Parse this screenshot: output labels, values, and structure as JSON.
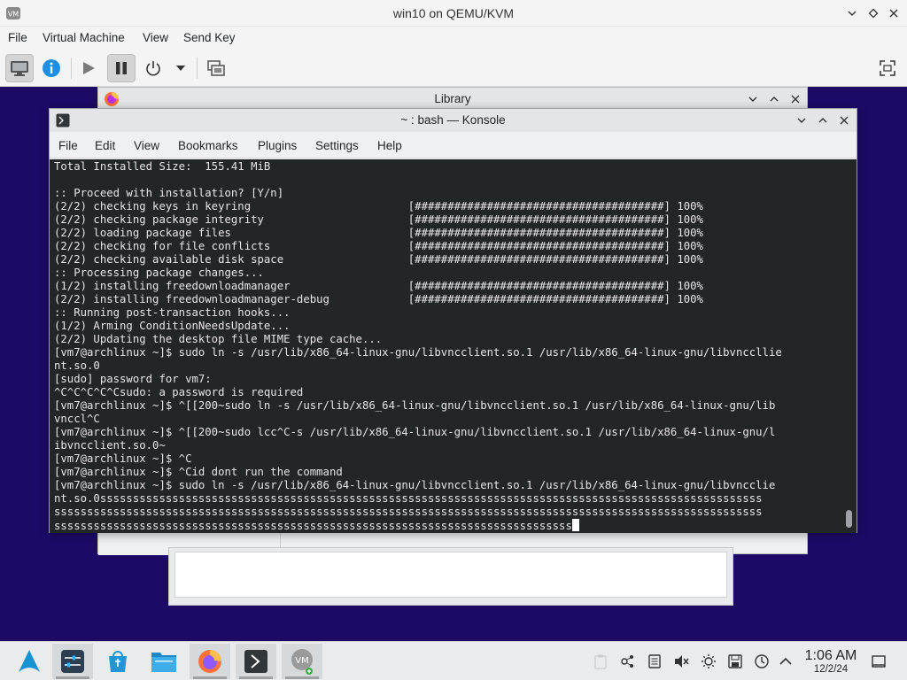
{
  "host_window": {
    "title": "win10 on QEMU/KVM",
    "menu": [
      "File",
      "Virtual Machine",
      "View",
      "Send Key"
    ],
    "toolbar_icons": [
      "console-icon",
      "info-icon",
      "play-icon",
      "pause-icon",
      "power-icon",
      "dropdown-icon",
      "snapshot-icon",
      "fullscreen-icon"
    ]
  },
  "library_window": {
    "title": "Library"
  },
  "konsole": {
    "title": "~ : bash — Konsole",
    "menu": [
      "File",
      "Edit",
      "View",
      "Bookmarks",
      "Plugins",
      "Settings",
      "Help"
    ],
    "lines": [
      "Total Installed Size:  155.41 MiB",
      "",
      ":: Proceed with installation? [Y/n]",
      "(2/2) checking keys in keyring                        [######################################] 100%",
      "(2/2) checking package integrity                      [######################################] 100%",
      "(2/2) loading package files                           [######################################] 100%",
      "(2/2) checking for file conflicts                     [######################################] 100%",
      "(2/2) checking available disk space                   [######################################] 100%",
      ":: Processing package changes...",
      "(1/2) installing freedownloadmanager                  [######################################] 100%",
      "(2/2) installing freedownloadmanager-debug            [######################################] 100%",
      ":: Running post-transaction hooks...",
      "(1/2) Arming ConditionNeedsUpdate...",
      "(2/2) Updating the desktop file MIME type cache...",
      "[vm7@archlinux ~]$ sudo ln -s /usr/lib/x86_64-linux-gnu/libvncclient.so.1 /usr/lib/x86_64-linux-gnu/libvnccllie",
      "nt.so.0",
      "[sudo] password for vm7:",
      "^C^C^C^C^Csudo: a password is required",
      "[vm7@archlinux ~]$ ^[[200~sudo ln -s /usr/lib/x86_64-linux-gnu/libvncclient.so.1 /usr/lib/x86_64-linux-gnu/lib",
      "vnccl^C",
      "[vm7@archlinux ~]$ ^[[200~sudo lcc^C-s /usr/lib/x86_64-linux-gnu/libvncclient.so.1 /usr/lib/x86_64-linux-gnu/l",
      "ibvncclient.so.0~",
      "[vm7@archlinux ~]$ ^C",
      "[vm7@archlinux ~]$ ^Cid dont run the command",
      "[vm7@archlinux ~]$ sudo ln -s /usr/lib/x86_64-linux-gnu/libvncclient.so.1 /usr/lib/x86_64-linux-gnu/libvncclie",
      "nt.so.0sssssssssssssssssssssssssssssssssssssssssssssssssssssssssssssssssssssssssssssssssssssssssssssssssssss",
      "ssssssssssssssssssssssssssssssssssssssssssssssssssssssssssssssssssssssssssssssssssssssssssssssssssssssssssss",
      "sssssssssssssssssssssssssssssssssssssssssssssssssssssssssssssssssssssssssssssss"
    ]
  },
  "taskbar": {
    "apps": [
      "arch-launcher-icon",
      "system-settings-icon",
      "discover-icon",
      "file-manager-icon",
      "firefox-icon",
      "konsole-icon",
      "virt-manager-icon"
    ],
    "tray": [
      "clipboard-icon",
      "network-icon",
      "storage-icon",
      "volume-muted-icon",
      "brightness-icon",
      "save-icon",
      "updates-icon",
      "chevron-up-icon"
    ],
    "time": "1:06 AM",
    "date": "12/2/24"
  }
}
